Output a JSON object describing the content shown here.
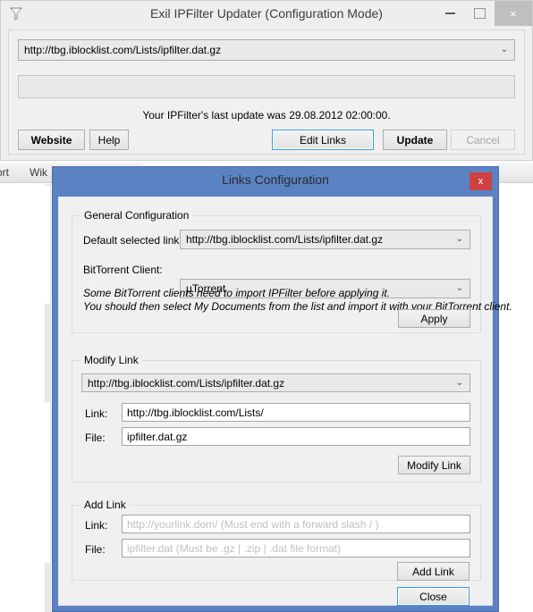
{
  "background": {
    "menu_items": [
      "ort",
      "Wik"
    ]
  },
  "main_window": {
    "icon": "funnel-filter-icon",
    "title": "Exil IPFilter Updater (Configuration Mode)",
    "window_buttons": {
      "minimize": "minimize-icon",
      "maximize": "maximize-icon",
      "close": "×"
    },
    "url_combo": {
      "value": "http://tbg.iblocklist.com/Lists/ipfilter.dat.gz",
      "arrow": "⌄"
    },
    "progress": {
      "percent": 0
    },
    "status_text": "Your IPFilter's last update was 29.08.2012 02:00:00.",
    "buttons": {
      "website": "Website",
      "help": "Help",
      "edit_links": "Edit Links",
      "update": "Update",
      "cancel": "Cancel"
    }
  },
  "dialog": {
    "title": "Links Configuration",
    "close_label": "x",
    "accent_color": "#5b82c3",
    "close_color": "#cf4040",
    "general": {
      "legend": "General Configuration",
      "default_link_label": "Default selected link:",
      "default_link_value": "http://tbg.iblocklist.com/Lists/ipfilter.dat.gz",
      "client_label": "BitTorrent Client:",
      "client_value": "µTorrent",
      "hint_line1": "Some BitTorrent clients need to import IPFilter before applying it.",
      "hint_line2": "You should then select My Documents from the list and import it with your BitTorrent client.",
      "apply_label": "Apply",
      "arrow": "⌄"
    },
    "modify": {
      "legend": "Modify Link",
      "selected_value": "http://tbg.iblocklist.com/Lists/ipfilter.dat.gz",
      "link_label": "Link:",
      "link_value": "http://tbg.iblocklist.com/Lists/",
      "file_label": "File:",
      "file_value": "ipfilter.dat.gz",
      "modify_label": "Modify Link",
      "arrow": "⌄"
    },
    "add": {
      "legend": "Add Link",
      "link_label": "Link:",
      "link_placeholder": "http://yourlink.dom/ (Must end with a forward slash / )",
      "file_label": "File:",
      "file_placeholder": "ipfilter.dat (Must be .gz | .zip | .dat file format)",
      "add_label": "Add Link"
    },
    "close_button_label": "Close"
  }
}
